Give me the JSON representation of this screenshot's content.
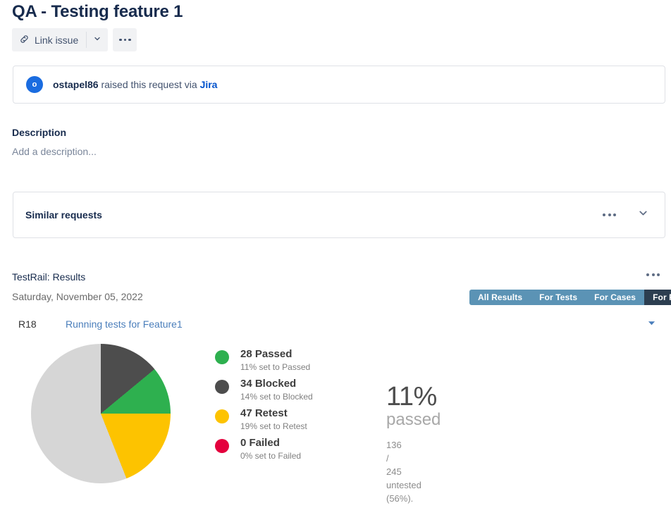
{
  "page_title": "QA - Testing feature 1",
  "toolbar": {
    "link_issue_label": "Link issue",
    "link_icon": "link-chain-icon",
    "caret_icon": "chevron-down-icon",
    "more_icon": "ellipsis-icon"
  },
  "request_banner": {
    "avatar_initial": "o",
    "reporter": "ostapel86",
    "middle_text": " raised this request via ",
    "source": "Jira"
  },
  "description": {
    "heading": "Description",
    "placeholder": "Add a description..."
  },
  "similar_requests": {
    "title": "Similar requests",
    "more_icon": "ellipsis-icon",
    "expand_icon": "chevron-down-icon"
  },
  "testrail": {
    "heading": "TestRail: Results",
    "date": "Saturday, November 05, 2022",
    "menu_icon": "ellipsis-icon",
    "tabs": [
      {
        "label": "All Results",
        "active": false
      },
      {
        "label": "For Tests",
        "active": false
      },
      {
        "label": "For Cases",
        "active": false
      },
      {
        "label": "For Runs",
        "active": true
      }
    ],
    "run": {
      "id": "R18",
      "name": "Running tests for Feature1",
      "caret_icon": "caret-down-icon"
    },
    "summary": {
      "percent": "11%",
      "label": "passed",
      "detail_numerator": "136",
      "detail_slash": "/",
      "detail_denominator": "245",
      "detail_word": "untested",
      "detail_pct": "(56%)."
    }
  },
  "chart_data": {
    "type": "pie",
    "title": "TestRail: Results",
    "legend_position": "right",
    "categories": [
      "Blocked",
      "Passed",
      "Retest",
      "Untested"
    ],
    "values": [
      14,
      11,
      19,
      56
    ],
    "counts": [
      34,
      28,
      47,
      136
    ],
    "colors": [
      "#4d4d4d",
      "#2eb04f",
      "#fdc300",
      "#d6d6d6"
    ],
    "start_angle_deg": 0,
    "total_tests": 245,
    "legend": [
      {
        "count_label": "28 Passed",
        "sub_label": "11% set to Passed",
        "color": "#2eb04f",
        "swatch": "passed-swatch"
      },
      {
        "count_label": "34 Blocked",
        "sub_label": "14% set to Blocked",
        "color": "#4d4d4d",
        "swatch": "blocked-swatch"
      },
      {
        "count_label": "47 Retest",
        "sub_label": "19% set to Retest",
        "color": "#fdc300",
        "swatch": "retest-swatch"
      },
      {
        "count_label": "0 Failed",
        "sub_label": "0% set to Failed",
        "color": "#e4003d",
        "swatch": "failed-swatch"
      }
    ]
  }
}
